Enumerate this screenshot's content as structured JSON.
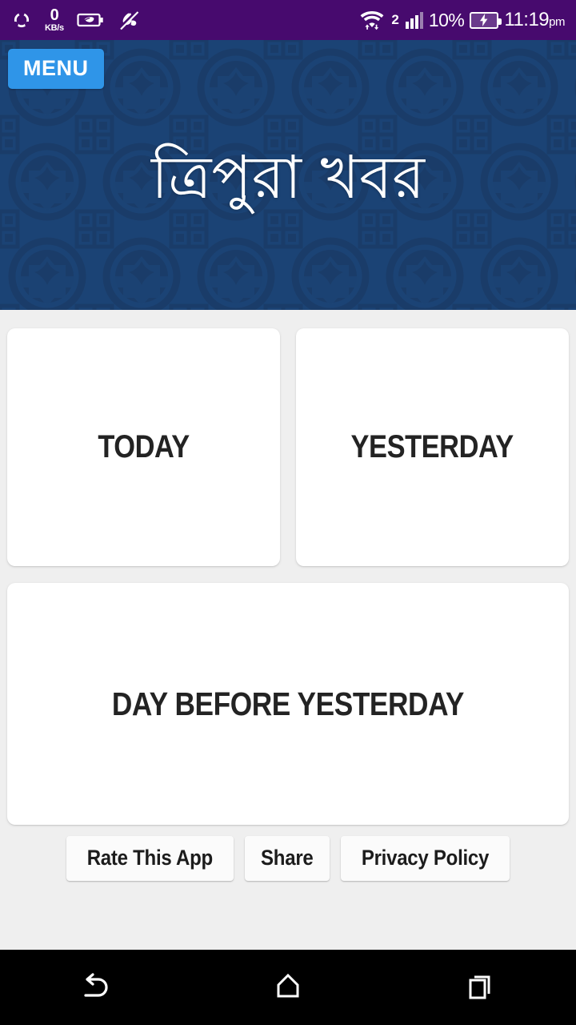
{
  "status_bar": {
    "background_color": "#470a6e",
    "left_icons": [
      {
        "name": "sync-share-icon",
        "label": "sync"
      },
      {
        "name": "stamina-battery-leaf-icon",
        "label": "stamina mode"
      },
      {
        "name": "sound-muted-icon",
        "label": "muted"
      }
    ],
    "data_rate": {
      "value": "0",
      "unit": "KB/s"
    },
    "wifi": {
      "name": "wifi-transfer-icon",
      "label": "wifi"
    },
    "signal": {
      "sim_label": "2",
      "bars_active": 3,
      "bars_total": 4
    },
    "battery_percent": "10%",
    "battery_state": "charging",
    "clock": {
      "time": "11:19",
      "ampm": "pm"
    }
  },
  "banner": {
    "background_color": "#1b4375",
    "pattern_color": "#1a3c69",
    "menu_label": "MENU",
    "menu_color": "#2f95e8",
    "title": "ত্রিপুরা খবর"
  },
  "main": {
    "background_color": "#efefef",
    "cards": [
      {
        "label": "TODAY"
      },
      {
        "label": "YESTERDAY"
      },
      {
        "label": "DAY BEFORE YESTERDAY"
      }
    ],
    "footer_buttons": [
      {
        "label": "Rate This App"
      },
      {
        "label": "Share"
      },
      {
        "label": "Privacy Policy"
      }
    ]
  },
  "nav_bar": {
    "background_color": "#000000",
    "buttons": [
      {
        "name": "back-button",
        "label": "Back"
      },
      {
        "name": "home-button",
        "label": "Home"
      },
      {
        "name": "recents-button",
        "label": "Recents"
      }
    ]
  }
}
